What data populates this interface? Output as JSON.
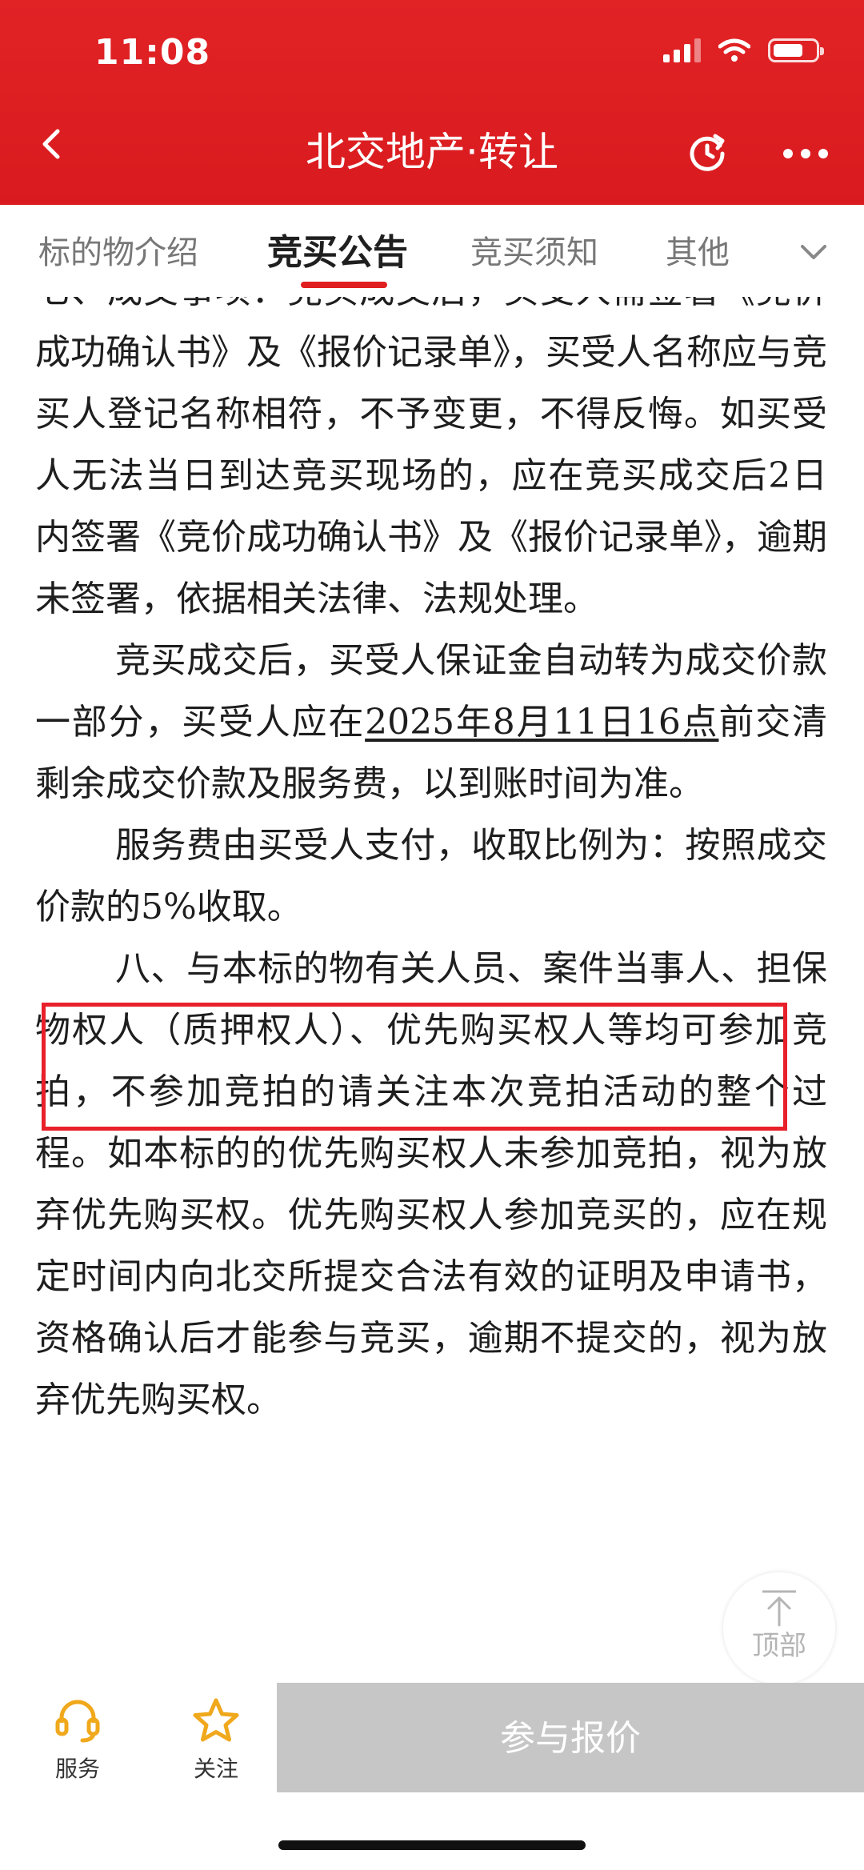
{
  "status_bar": {
    "time": "11:08"
  },
  "nav": {
    "title": "北交地产·转让"
  },
  "tabs": [
    {
      "label": "标的物介绍",
      "active": false
    },
    {
      "label": "竞买公告",
      "active": true
    },
    {
      "label": "竞买须知",
      "active": false
    },
    {
      "label": "其他",
      "active": false
    }
  ],
  "article": {
    "p1": "七、成交事项：竞买成交后，买受人需签署《竞价成功确认书》及《报价记录单》，买受人名称应与竞买人登记名称相符，不予变更，不得反悔。如买受人无法当日到达竞买现场的，应在竞买成交后2日内签署《竞价成功确认书》及《报价记录单》，逾期未签署，依据相关法律、法规处理。",
    "p2_before": "竞买成交后，买受人保证金自动转为成交价款一部分，买受人应在",
    "p2_deadline": "2025年8月11日16点",
    "p2_after": "前交清剩余成交价款及服务费，以到账时间为准。",
    "p3": "服务费由买受人支付，收取比例为：按照成交价款的5%收取。",
    "p4": "八、与本标的物有关人员、案件当事人、担保物权人（质押权人）、优先购买权人等均可参加竞拍，不参加竞拍的请关注本次竞拍活动的整个过程。如本标的的优先购买权人未参加竞拍，视为放弃优先购买权。优先购买权人参加竞买的，应在规定时间内向北交所提交合法有效的证明及申请书，资格确认后才能参与竞买，逾期不提交的，视为放弃优先购买权。"
  },
  "back_to_top": {
    "label": "顶部"
  },
  "bottom_bar": {
    "service_label": "服务",
    "follow_label": "关注",
    "bid_label": "参与报价"
  },
  "colors": {
    "brand_red": "#d91b1f",
    "highlight_border": "#e8202a",
    "star": "#f0a81c",
    "disabled_button": "#c6c6c6"
  }
}
